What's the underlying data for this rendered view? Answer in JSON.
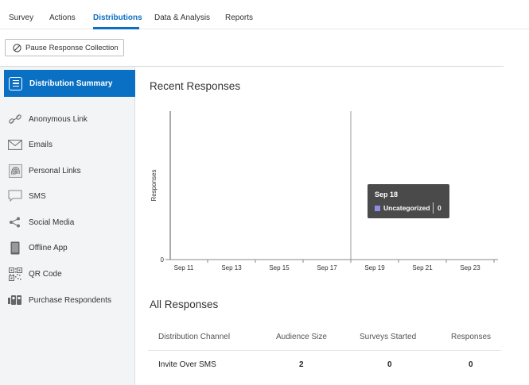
{
  "tabs": [
    {
      "label": "Survey"
    },
    {
      "label": "Actions"
    },
    {
      "label": "Distributions"
    },
    {
      "label": "Data & Analysis"
    },
    {
      "label": "Reports"
    }
  ],
  "active_tab": "Distributions",
  "pause_button": "Pause Response Collection",
  "sidebar": {
    "active": "Distribution Summary",
    "items": [
      {
        "label": "Anonymous Link",
        "icon": "link-icon"
      },
      {
        "label": "Emails",
        "icon": "envelope-icon"
      },
      {
        "label": "Personal Links",
        "icon": "fingerprint-icon"
      },
      {
        "label": "SMS",
        "icon": "speech-bubble-icon"
      },
      {
        "label": "Social Media",
        "icon": "share-icon"
      },
      {
        "label": "Offline App",
        "icon": "tablet-icon"
      },
      {
        "label": "QR Code",
        "icon": "qr-code-icon"
      },
      {
        "label": "Purchase Respondents",
        "icon": "people-icon"
      }
    ]
  },
  "recent_title": "Recent Responses",
  "chart_data": {
    "type": "bar",
    "title": "Recent Responses",
    "ylabel": "Responses",
    "xlabel": "",
    "x_tick_labels": [
      "Sep 11",
      "Sep 13",
      "Sep 15",
      "Sep 17",
      "Sep 19",
      "Sep 21",
      "Sep 23"
    ],
    "y_tick_labels": [
      "0"
    ],
    "series": [
      {
        "name": "Uncategorized",
        "values": [
          {
            "x": "Sep 18",
            "y": 0
          }
        ]
      }
    ],
    "hover_x": "Sep 18",
    "colors": {
      "Uncategorized": "#8f8ee6"
    },
    "grid": false
  },
  "tooltip": {
    "date": "Sep 18",
    "series": "Uncategorized",
    "value": "0"
  },
  "all_title": "All Responses",
  "table": {
    "headers": [
      "Distribution Channel",
      "Audience Size",
      "Surveys Started",
      "Responses"
    ],
    "rows": [
      [
        "Invite Over SMS",
        "2",
        "0",
        "0"
      ]
    ]
  },
  "colors": {
    "accent": "#0a70c4",
    "sidebar_bg": "#f2f4f6",
    "tooltip_bg": "#4a4a4a"
  }
}
